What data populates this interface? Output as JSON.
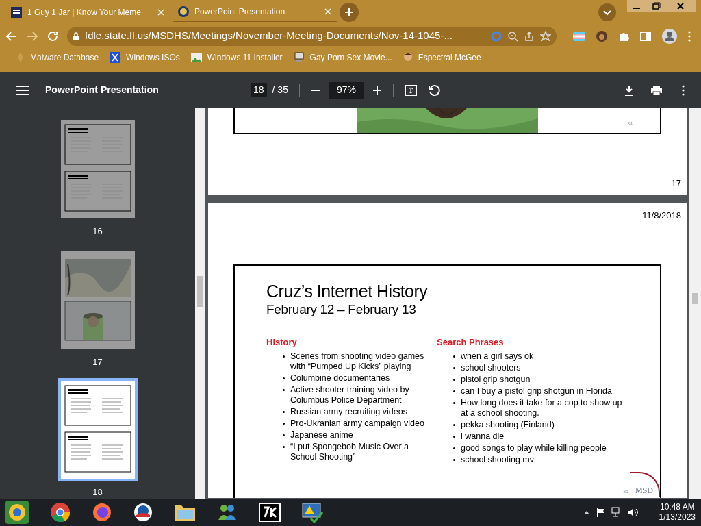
{
  "browser": {
    "tabs": [
      {
        "title": "1 Guy 1 Jar | Know Your Meme",
        "selected": false
      },
      {
        "title": "PowerPoint Presentation",
        "selected": true
      }
    ],
    "address": "fdle.state.fl.us/MSDHS/Meetings/November-Meeting-Documents/Nov-14-1045-...",
    "bookmarks": [
      "Malware Database",
      "Windows ISOs",
      "Windows 11 Installer",
      "Gay Porn Sex Movie...",
      "Espectral McGee"
    ]
  },
  "pdf_toolbar": {
    "title": "PowerPoint Presentation",
    "page": "18",
    "total": "/ 35",
    "zoom": "97%"
  },
  "thumbnails": [
    {
      "label": "16",
      "kind": "text",
      "selected": false
    },
    {
      "label": "17",
      "selected": false
    },
    {
      "label": "18",
      "kind": "text",
      "selected": true
    }
  ],
  "page_17": {
    "slide_number": "34",
    "page_number": "17"
  },
  "page_18": {
    "date": "11/8/2018",
    "title": "Cruz’s Internet History",
    "subtitle": "February 12 – February 13",
    "columns": [
      {
        "heading": "History",
        "items": [
          "Scenes from shooting video games with “Pumped Up Kicks” playing",
          "Columbine documentaries",
          "Active shooter training video by Columbus Police Department",
          "Russian army recruiting videos",
          "Pro-Ukranian army campaign video",
          "Japanese anime",
          "“I put Spongebob Music Over a School Shooting”"
        ]
      },
      {
        "heading": "Search Phrases",
        "items": [
          "when a girl says ok",
          "school shooters",
          "pistol grip shotgun",
          "can I buy a pistol grip shotgun in Florida",
          "How long does it take for a cop to show up at a school shooting.",
          "pekka shooting (Finland)",
          "i wanna die",
          "good songs to play while killing people",
          "school shooting mv"
        ]
      }
    ],
    "slide_number": "35",
    "logo_text": "MSD"
  },
  "taskbar": {
    "time": "10:48 AM",
    "date": "1/13/2023"
  }
}
